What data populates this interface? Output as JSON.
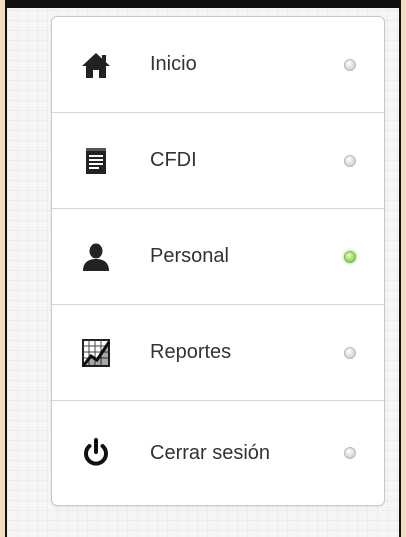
{
  "menu": {
    "items": [
      {
        "label": "Inicio",
        "icon": "home-icon",
        "active": false
      },
      {
        "label": "CFDI",
        "icon": "document-icon",
        "active": false
      },
      {
        "label": "Personal",
        "icon": "user-icon",
        "active": true
      },
      {
        "label": "Reportes",
        "icon": "chart-icon",
        "active": false
      },
      {
        "label": "Cerrar sesión",
        "icon": "power-icon",
        "active": false
      }
    ]
  },
  "colors": {
    "active_indicator": "#8ed04f",
    "inactive_indicator": "#d6d6d6",
    "icon": "#222222",
    "text": "#333333"
  }
}
